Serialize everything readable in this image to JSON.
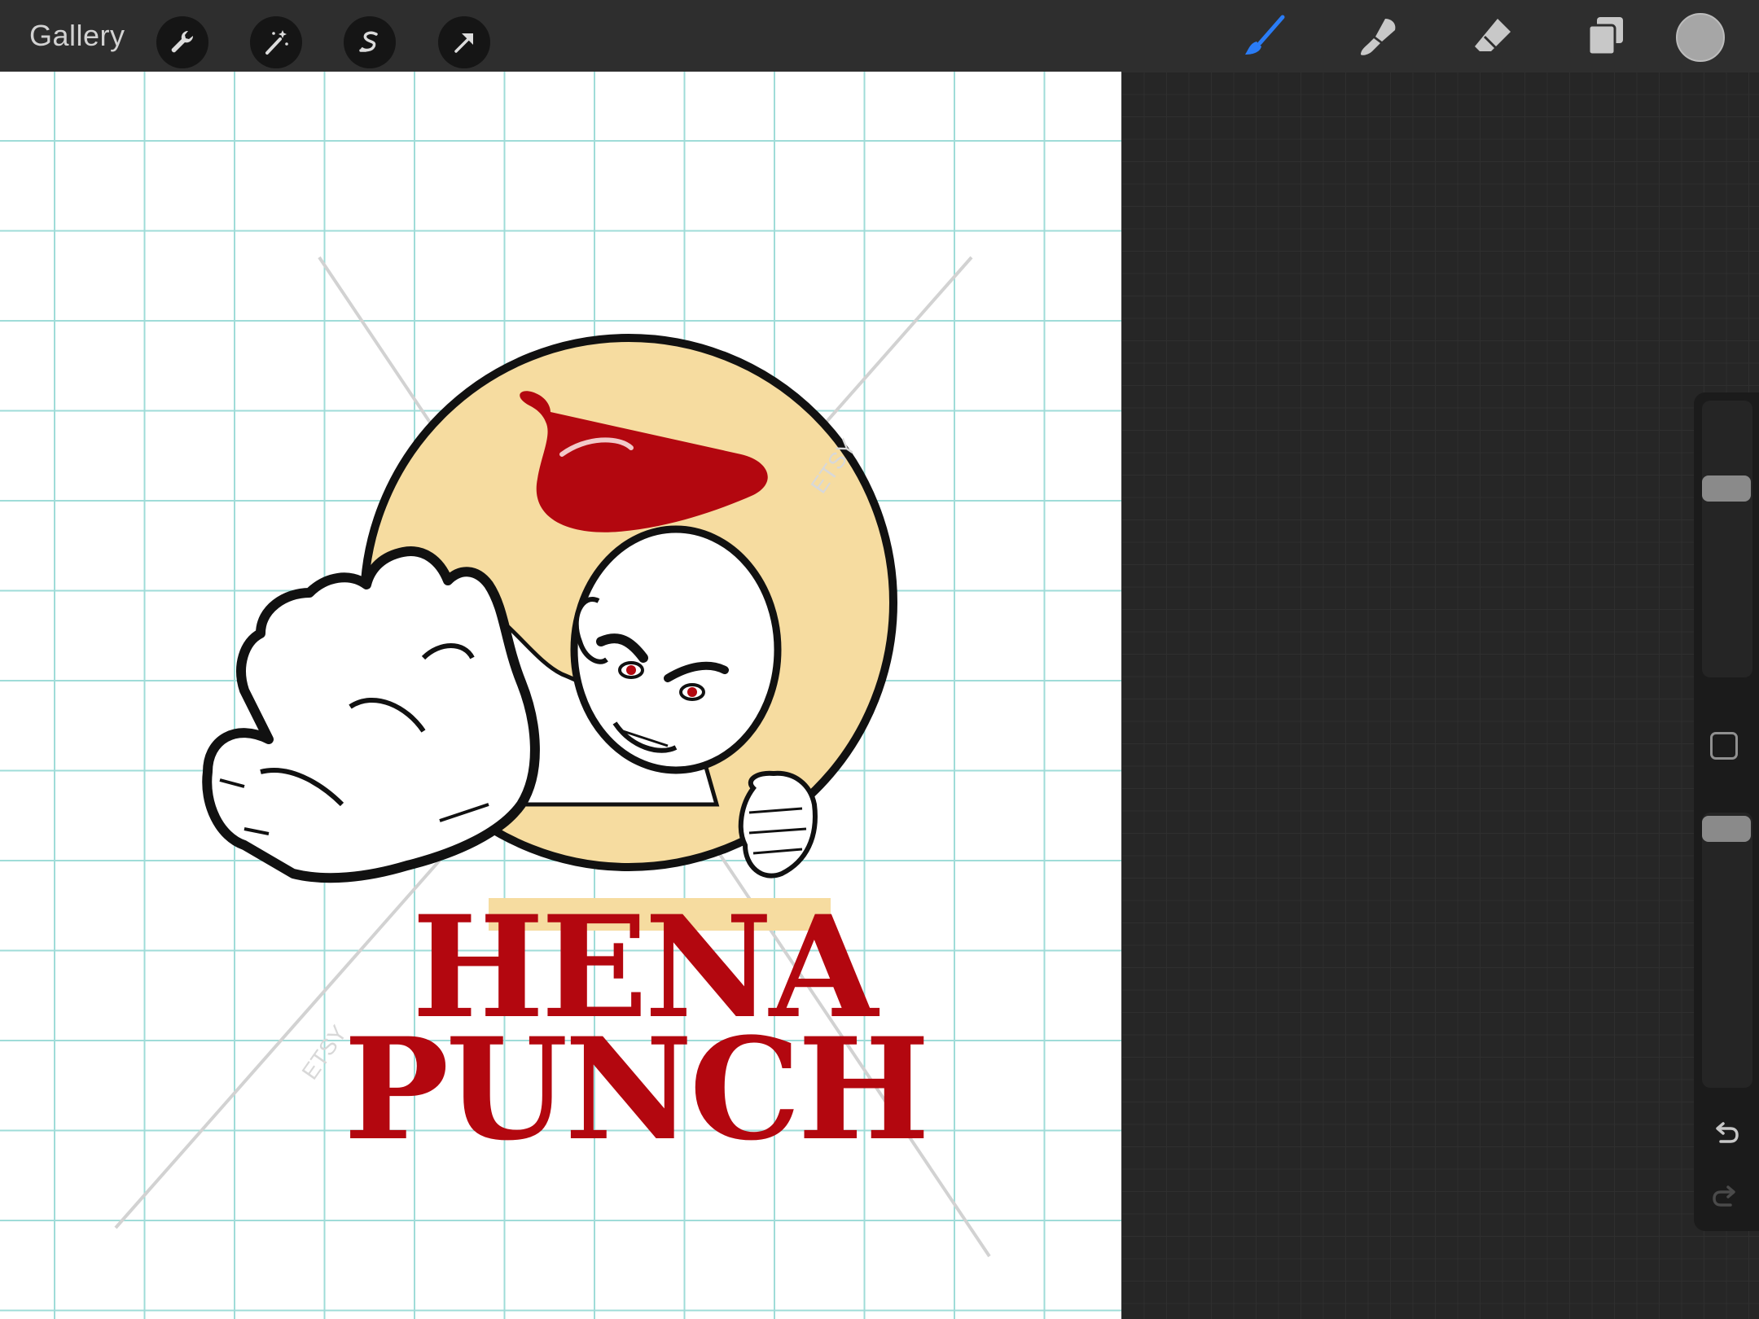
{
  "toolbar": {
    "gallery_label": "Gallery",
    "left_tools": [
      "wrench-icon",
      "magic-wand-icon",
      "selection-icon",
      "arrow-icon"
    ],
    "right_tools": [
      "brush-icon",
      "smudge-icon",
      "eraser-icon",
      "layers-icon"
    ],
    "active_tool": "brush-icon",
    "accent_color": "#2a7cf6",
    "current_color": "#a6a6a6"
  },
  "canvas": {
    "logo_line1": "HENA",
    "logo_line2": "PUNCH",
    "watermark": "ETSY",
    "colors": {
      "red": "#b3070f",
      "cream": "#f6dca0",
      "ink": "#111111",
      "grid": "#9fdcd8"
    }
  },
  "sidebar": {
    "brush_size_level": 0.7,
    "opacity_level": 1.0,
    "undo_icon": "undo-icon",
    "redo_icon": "redo-icon"
  }
}
